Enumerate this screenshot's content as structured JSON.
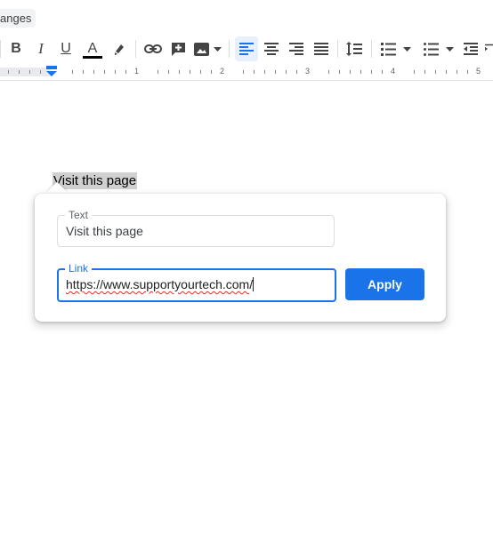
{
  "header": {
    "changes_chip": "anges"
  },
  "toolbar": {
    "items": [
      {
        "name": "bold",
        "glyph": "B"
      },
      {
        "name": "italic",
        "glyph": "I"
      },
      {
        "name": "underline",
        "glyph": "U"
      },
      {
        "name": "text-color",
        "glyph": "A"
      }
    ],
    "accent": "#1a73e8"
  },
  "ruler": {
    "numbers": [
      "1",
      "2",
      "3",
      "4",
      "5"
    ]
  },
  "document": {
    "highlighted_text": "Visit this page"
  },
  "link_dialog": {
    "text_label": "Text",
    "text_value": "Visit this page",
    "link_label": "Link",
    "link_prefix": "https://",
    "link_domain": "www.supportyourtech.com",
    "link_suffix": "/",
    "apply_label": "Apply"
  },
  "colors": {
    "apply": "#1a73e8",
    "focus_border": "#1a73e8",
    "highlight": "#d0d0d0"
  }
}
